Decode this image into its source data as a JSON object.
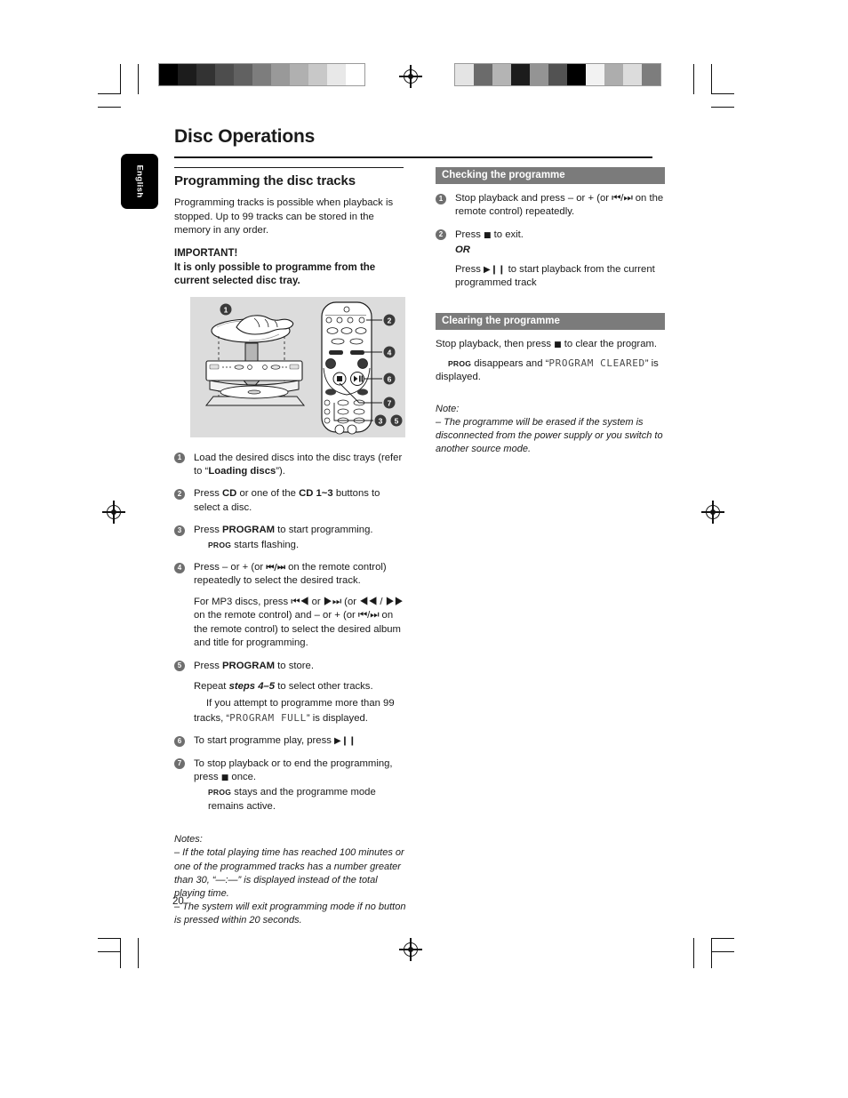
{
  "document": {
    "page_title": "Disc Operations",
    "page_number": "20",
    "language_tab": "English"
  },
  "left_column": {
    "section_heading": "Programming the disc tracks",
    "intro": "Programming tracks is possible when playback is stopped.  Up to 99 tracks can be stored in the memory in any order.",
    "important_label": "IMPORTANT!",
    "important_text": "It is only possible to programme from the current selected disc tray.",
    "figure": {
      "callouts": [
        "1",
        "2",
        "3",
        "4",
        "5",
        "6",
        "7"
      ],
      "description": "Loading a disc into the disc tray and remote control key callouts"
    },
    "steps": [
      {
        "num": "1",
        "text_parts": [
          "Load the desired discs into the disc trays (refer to “",
          "Loading discs",
          "”)."
        ]
      },
      {
        "num": "2",
        "text_parts": [
          "Press ",
          "CD",
          " or one of the ",
          "CD 1~3",
          " buttons to select a disc."
        ]
      },
      {
        "num": "3",
        "text_parts": [
          "Press ",
          "PROGRAM",
          " to start programming."
        ],
        "sub_prog": "PROG",
        "sub_text": " starts flashing."
      },
      {
        "num": "4",
        "text_parts": [
          "Press – or + (or ",
          "⏮/⏭",
          "  on the remote control) repeatedly to select the desired track."
        ],
        "extra": "For MP3 discs, press ⏮◀ or ▶⏭  (or ◀◀ / ▶▶ on the remote control)  and – or + (or ⏮/⏭ on the remote control) to select the desired album and title for programming."
      },
      {
        "num": "5",
        "text_parts": [
          "Press ",
          "PROGRAM",
          " to store."
        ],
        "repeat_pre": "Repeat ",
        "repeat_bold": "steps 4–5",
        "repeat_post": " to select other tracks.",
        "full_pre": "If you attempt to programme more than 99 tracks, “",
        "full_lcd": "PROGRAM FULL",
        "full_post": "” is displayed."
      },
      {
        "num": "6",
        "text_parts": [
          "To start programme play, press  ",
          "▶❙❙"
        ]
      },
      {
        "num": "7",
        "text_parts": [
          "To stop playback or to end the programming, press ",
          "■",
          " once."
        ],
        "sub_prog": "PROG",
        "sub_text": " stays and the programme mode remains active."
      }
    ],
    "notes_label": "Notes:",
    "note_1": "–  If the total playing time has reached 100 minutes or one of the programmed tracks has a number greater than 30, “—:—” is displayed instead of the total playing time.",
    "note_2": "–  The system will exit programming mode if no button is pressed within 20 seconds."
  },
  "right_column": {
    "checking": {
      "heading": "Checking the programme",
      "step_1": "Stop playback and press – or + (or  ⏮/⏭  on the remote control) repeatedly.",
      "step_2_pre": "Press ",
      "step_2_glyph": "■",
      "step_2_post": "  to exit.",
      "or": "OR",
      "step_2_alt_pre": "Press  ",
      "step_2_alt_glyph": "▶❙❙",
      "step_2_alt_post": " to start playback from the current programmed track"
    },
    "clearing": {
      "heading": "Clearing the programme",
      "text_pre": "Stop playback, then press ",
      "text_glyph": "■",
      "text_post": "  to clear the program.",
      "prog": "PROG",
      "disappears_pre": " disappears and “",
      "lcd": "PROGRAM CLEARED",
      "disappears_post": "” is displayed.",
      "note_label": "Note:",
      "note": "–  The programme will be erased if the system is disconnected from the power supply or you switch to another source mode."
    }
  },
  "print_marks": {
    "gray_strip_left": [
      "#000000",
      "#1c1c1c",
      "#333333",
      "#4d4d4d",
      "#616161",
      "#7d7d7d",
      "#999999",
      "#b0b0b0",
      "#c8c8c8",
      "#e8e8e8",
      "#ffffff"
    ],
    "gray_strip_right": [
      "#e4e4e4",
      "#6b6b6b",
      "#b4b4b4",
      "#1c1c1c",
      "#949494",
      "#525252",
      "#000000",
      "#f2f2f2",
      "#adadad",
      "#dcdcdc",
      "#7d7d7d"
    ]
  }
}
